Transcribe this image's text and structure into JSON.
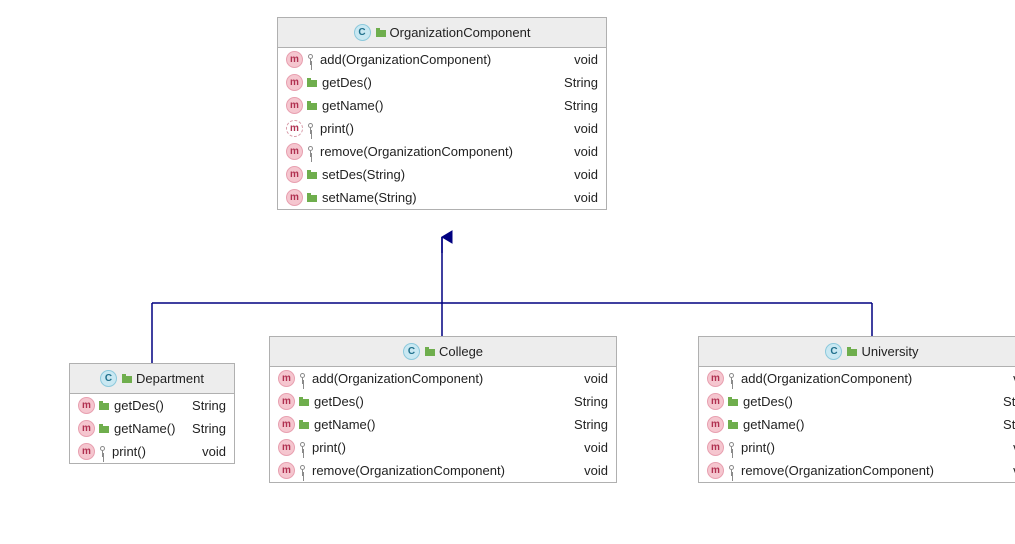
{
  "classes": {
    "parent": {
      "name": "OrganizationComponent",
      "stereotype": "class",
      "methods": [
        {
          "icon": "m",
          "vis": "key",
          "name": "add(OrganizationComponent)",
          "return": "void"
        },
        {
          "icon": "m",
          "vis": "pkg",
          "name": "getDes()",
          "return": "String"
        },
        {
          "icon": "m",
          "vis": "pkg",
          "name": "getName()",
          "return": "String"
        },
        {
          "icon": "m-abs",
          "vis": "key",
          "name": "print()",
          "return": "void"
        },
        {
          "icon": "m",
          "vis": "key",
          "name": "remove(OrganizationComponent)",
          "return": "void"
        },
        {
          "icon": "m",
          "vis": "pkg",
          "name": "setDes(String)",
          "return": "void"
        },
        {
          "icon": "m",
          "vis": "pkg",
          "name": "setName(String)",
          "return": "void"
        }
      ]
    },
    "department": {
      "name": "Department",
      "stereotype": "class",
      "methods": [
        {
          "icon": "m",
          "vis": "pkg",
          "name": "getDes()",
          "return": "String"
        },
        {
          "icon": "m",
          "vis": "pkg",
          "name": "getName()",
          "return": "String"
        },
        {
          "icon": "m",
          "vis": "key",
          "name": "print()",
          "return": "void"
        }
      ]
    },
    "college": {
      "name": "College",
      "stereotype": "class",
      "methods": [
        {
          "icon": "m",
          "vis": "key",
          "name": "add(OrganizationComponent)",
          "return": "void"
        },
        {
          "icon": "m",
          "vis": "pkg",
          "name": "getDes()",
          "return": "String"
        },
        {
          "icon": "m",
          "vis": "pkg",
          "name": "getName()",
          "return": "String"
        },
        {
          "icon": "m",
          "vis": "key",
          "name": "print()",
          "return": "void"
        },
        {
          "icon": "m",
          "vis": "key",
          "name": "remove(OrganizationComponent)",
          "return": "void"
        }
      ]
    },
    "university": {
      "name": "University",
      "stereotype": "class",
      "methods": [
        {
          "icon": "m",
          "vis": "key",
          "name": "add(OrganizationComponent)",
          "return": "void"
        },
        {
          "icon": "m",
          "vis": "pkg",
          "name": "getDes()",
          "return": "String"
        },
        {
          "icon": "m",
          "vis": "pkg",
          "name": "getName()",
          "return": "String"
        },
        {
          "icon": "m",
          "vis": "key",
          "name": "print()",
          "return": "void"
        },
        {
          "icon": "m",
          "vis": "key",
          "name": "remove(OrganizationComponent)",
          "return": "void"
        }
      ]
    }
  },
  "relationships": [
    {
      "from": "Department",
      "to": "OrganizationComponent",
      "type": "generalization"
    },
    {
      "from": "College",
      "to": "OrganizationComponent",
      "type": "generalization"
    },
    {
      "from": "University",
      "to": "OrganizationComponent",
      "type": "generalization"
    }
  ],
  "colors": {
    "border": "#b0b0b0",
    "header_bg": "#ededed",
    "arrow": "#000080"
  }
}
